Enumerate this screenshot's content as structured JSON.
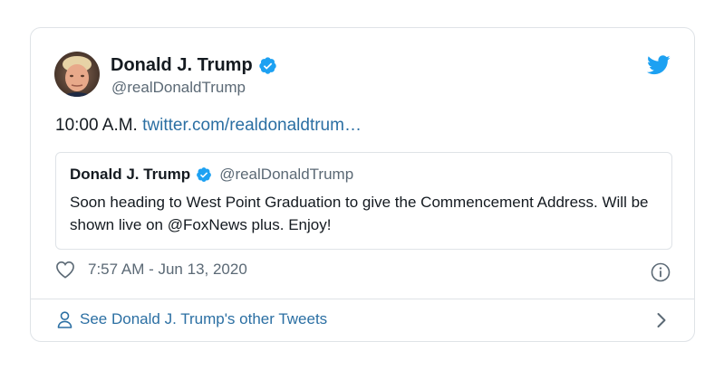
{
  "author": {
    "name": "Donald J. Trump",
    "handle": "@realDonaldTrump"
  },
  "tweet": {
    "prefix": "10:00 A.M.",
    "link_text": "twitter.com/realdonaldtrum…"
  },
  "quoted_tweet": {
    "name": "Donald J. Trump",
    "handle": "@realDonaldTrump",
    "text": "Soon heading to West Point Graduation to give the Commencement Address. Will be shown live on @FoxNews plus. Enjoy!"
  },
  "meta": {
    "timestamp": "7:57 AM - Jun 13, 2020"
  },
  "footer": {
    "link_text": "See Donald J. Trump's other Tweets"
  },
  "colors": {
    "twitter_blue": "#1da1f2",
    "link_blue": "#2b6fa3",
    "text": "#141a20",
    "muted": "#5b6975",
    "border": "#dfe3e7"
  },
  "icons": [
    "verified-badge-icon",
    "twitter-bird-icon",
    "heart-icon",
    "info-icon",
    "person-icon",
    "chevron-right-icon"
  ]
}
